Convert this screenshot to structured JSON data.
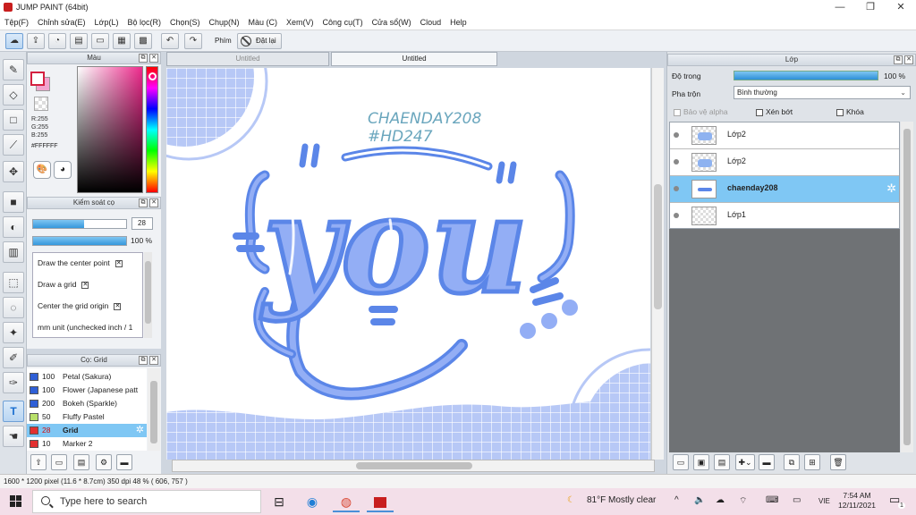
{
  "window": {
    "title": "JUMP PAINT (64bit)",
    "minimize": "—",
    "maximize": "❐",
    "close": "✕"
  },
  "menu": [
    "Tệp(F)",
    "Chỉnh sửa(E)",
    "Lớp(L)",
    "Bộ lọc(R)",
    "Chọn(S)",
    "Chụp(N)",
    "Màu (C)",
    "Xem(V)",
    "Công cụ(T)",
    "Cửa sổ(W)",
    "Cloud",
    "Help"
  ],
  "toolbar": {
    "pen_label": "Phím",
    "reset_label": "Đặt lại"
  },
  "color_panel": {
    "title": "Màu",
    "r": "R:255",
    "g": "G:255",
    "b": "B:255",
    "hex": "#FFFFFF",
    "fg_color": "#FFFFFF",
    "bg_color": "#F2A3CF"
  },
  "brush_control": {
    "title": "Kiểm soát cọ",
    "size": "28",
    "size_fill_pct": 55,
    "opacity": "100 %",
    "opacity_fill_pct": 100,
    "options": [
      {
        "label": "Draw the center point",
        "checked": true
      },
      {
        "label": "Draw a grid",
        "checked": true
      },
      {
        "label": "Center the grid origin",
        "checked": true
      },
      {
        "label": "mm unit (unchecked inch / 1",
        "checked": false
      }
    ]
  },
  "brush_presets": {
    "title": "Cọ: Grid",
    "items": [
      {
        "size": "100",
        "label": "Petal (Sakura)",
        "color": "#2f5fd6",
        "selected": false
      },
      {
        "size": "100",
        "label": "Flower (Japanese patt",
        "color": "#2f5fd6",
        "selected": false
      },
      {
        "size": "200",
        "label": "Bokeh (Sparkle)",
        "color": "#2f5fd6",
        "selected": false
      },
      {
        "size": "50",
        "label": "Fluffy Pastel",
        "color": "#b8e06a",
        "selected": false
      },
      {
        "size": "28",
        "label": "Grid",
        "color": "#e23030",
        "selected": true
      },
      {
        "size": "10",
        "label": "Marker 2",
        "color": "#e23030",
        "selected": false
      }
    ]
  },
  "doc_tabs": [
    {
      "label": "Untitled",
      "active": false
    },
    {
      "label": "Untitled",
      "active": true
    }
  ],
  "canvas_art": {
    "line1": "CHAENDAY208",
    "line2": "#HD247",
    "word": "you",
    "accent": "#5b86e8",
    "fill": "#93aef5"
  },
  "layer_panel": {
    "title": "Lớp",
    "opacity_label": "Độ trong",
    "opacity_value": "100 %",
    "blend_label": "Pha trộn",
    "blend_value": "Bình thường",
    "opt_alpha": "Bảo vệ alpha",
    "opt_clip": "Xén bớt",
    "opt_lock": "Khóa",
    "layers": [
      {
        "name": "Lớp2",
        "selected": false
      },
      {
        "name": "Lớp2",
        "selected": false
      },
      {
        "name": "chaenday208",
        "selected": true
      },
      {
        "name": "Lớp1",
        "selected": false
      }
    ]
  },
  "status": {
    "text": "1600 * 1200 pixel  (11.6 * 8.7cm)  350 dpi  48 %  ( 606, 757 )"
  },
  "taskbar": {
    "search_placeholder": "Type here to search",
    "weather": "81°F  Mostly clear",
    "lang": "VIE",
    "time": "7:54 AM",
    "date": "12/11/2021",
    "notifications": "1"
  }
}
